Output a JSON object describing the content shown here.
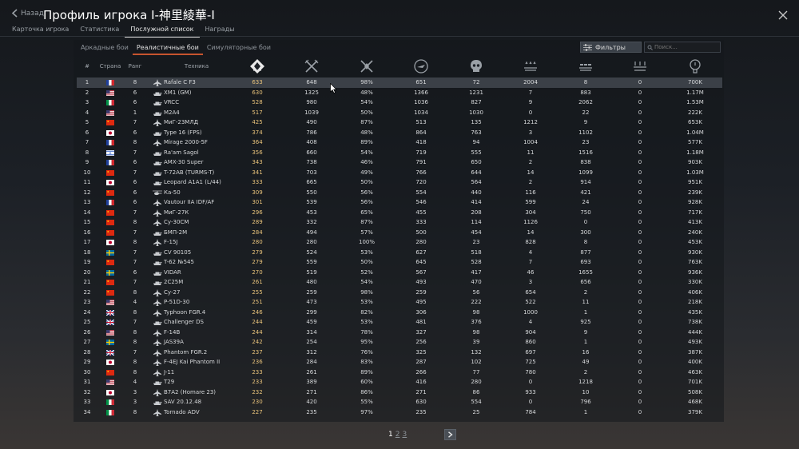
{
  "header": {
    "back_label": "Назад",
    "title": "Профиль игрока I-神里綾華-I",
    "tabs": [
      {
        "label": "Карточка игрока",
        "active": false
      },
      {
        "label": "Статистика",
        "active": false
      },
      {
        "label": "Послужной список",
        "active": true
      },
      {
        "label": "Награды",
        "active": false
      }
    ]
  },
  "modes": [
    {
      "label": "Аркадные бои",
      "active": false
    },
    {
      "label": "Реалистичные бои",
      "active": true
    },
    {
      "label": "Симуляторные бои",
      "active": false
    }
  ],
  "filters_label": "Фильтры",
  "search_placeholder": "Поиск...",
  "columns": {
    "num": "#",
    "country": "Страна",
    "rank": "Ранг",
    "vehicle": "Техника",
    "stat_icons": [
      "score-icon",
      "battles-icon",
      "victories-icon",
      "respawns-icon",
      "deaths-icon",
      "air-kills-icon",
      "ground-kills-icon",
      "naval-kills-icon",
      "experience-icon"
    ]
  },
  "flag_colors": {
    "fr": [
      "#1f3f9a",
      "#ffffff",
      "#d0282e"
    ],
    "us": [
      "#b22234",
      "#ffffff",
      "#3c3b6e"
    ],
    "it": [
      "#009246",
      "#ffffff",
      "#ce2b37"
    ],
    "cn": [
      "#de2910",
      "#ffde00"
    ],
    "jp": [
      "#ffffff",
      "#bc002d"
    ],
    "il": [
      "#ffffff",
      "#0038b8"
    ],
    "sv": [
      "#006aa7",
      "#fecc00"
    ],
    "uk": [
      "#012169",
      "#ffffff",
      "#c8102e"
    ]
  },
  "rows": [
    {
      "n": "1",
      "flag": "fr",
      "rank": "8",
      "type": "jet",
      "name": "Rafale C F3",
      "score": "633",
      "battles": "648",
      "wins": "98%",
      "respawns": "651",
      "deaths": "72",
      "air": "2004",
      "ground": "8",
      "naval": "0",
      "exp": "700K"
    },
    {
      "n": "2",
      "flag": "us",
      "rank": "6",
      "type": "tank",
      "name": "XM1 (GM)",
      "score": "630",
      "battles": "1325",
      "wins": "48%",
      "respawns": "1366",
      "deaths": "1231",
      "air": "7",
      "ground": "883",
      "naval": "0",
      "exp": "1.17M"
    },
    {
      "n": "3",
      "flag": "it",
      "rank": "6",
      "type": "tank",
      "name": "VRCC",
      "score": "528",
      "battles": "980",
      "wins": "54%",
      "respawns": "1036",
      "deaths": "827",
      "air": "9",
      "ground": "2062",
      "naval": "0",
      "exp": "1.53M"
    },
    {
      "n": "4",
      "flag": "us",
      "rank": "1",
      "type": "tank",
      "name": "M2A4",
      "score": "517",
      "battles": "1039",
      "wins": "50%",
      "respawns": "1034",
      "deaths": "1030",
      "air": "0",
      "ground": "22",
      "naval": "0",
      "exp": "222K"
    },
    {
      "n": "5",
      "flag": "cn",
      "rank": "7",
      "type": "jet",
      "name": "МиГ-23МЛД",
      "score": "425",
      "battles": "490",
      "wins": "87%",
      "respawns": "513",
      "deaths": "135",
      "air": "1212",
      "ground": "9",
      "naval": "0",
      "exp": "653K"
    },
    {
      "n": "6",
      "flag": "jp",
      "rank": "6",
      "type": "tank",
      "name": "Type 16 (FPS)",
      "score": "374",
      "battles": "786",
      "wins": "48%",
      "respawns": "864",
      "deaths": "763",
      "air": "3",
      "ground": "1102",
      "naval": "0",
      "exp": "1.04M"
    },
    {
      "n": "7",
      "flag": "fr",
      "rank": "8",
      "type": "jet",
      "name": "Mirage 2000-5F",
      "score": "364",
      "battles": "408",
      "wins": "89%",
      "respawns": "418",
      "deaths": "94",
      "air": "1004",
      "ground": "23",
      "naval": "0",
      "exp": "577K"
    },
    {
      "n": "8",
      "flag": "il",
      "rank": "7",
      "type": "tank",
      "name": "Ra'am Sagol",
      "score": "356",
      "battles": "660",
      "wins": "54%",
      "respawns": "719",
      "deaths": "555",
      "air": "11",
      "ground": "1516",
      "naval": "0",
      "exp": "1.18M"
    },
    {
      "n": "9",
      "flag": "fr",
      "rank": "6",
      "type": "tank",
      "name": "AMX-30 Super",
      "score": "343",
      "battles": "738",
      "wins": "46%",
      "respawns": "791",
      "deaths": "650",
      "air": "2",
      "ground": "838",
      "naval": "0",
      "exp": "903K"
    },
    {
      "n": "10",
      "flag": "cn",
      "rank": "7",
      "type": "tank",
      "name": "T-72AB (TURMS-T)",
      "score": "341",
      "battles": "703",
      "wins": "49%",
      "respawns": "766",
      "deaths": "644",
      "air": "14",
      "ground": "1099",
      "naval": "0",
      "exp": "1.03M"
    },
    {
      "n": "11",
      "flag": "jp",
      "rank": "6",
      "type": "tank",
      "name": "Leopard A1A1 (L/44)",
      "score": "333",
      "battles": "665",
      "wins": "50%",
      "respawns": "720",
      "deaths": "564",
      "air": "2",
      "ground": "914",
      "naval": "0",
      "exp": "951K"
    },
    {
      "n": "12",
      "flag": "cn",
      "rank": "6",
      "type": "heli",
      "name": "Ка-50",
      "score": "309",
      "battles": "550",
      "wins": "56%",
      "respawns": "554",
      "deaths": "440",
      "air": "116",
      "ground": "421",
      "naval": "0",
      "exp": "239K"
    },
    {
      "n": "13",
      "flag": "fr",
      "rank": "6",
      "type": "jet",
      "name": "Vautour IIA IDF/AF",
      "score": "301",
      "battles": "539",
      "wins": "56%",
      "respawns": "546",
      "deaths": "414",
      "air": "599",
      "ground": "24",
      "naval": "0",
      "exp": "928K"
    },
    {
      "n": "14",
      "flag": "cn",
      "rank": "7",
      "type": "jet",
      "name": "МиГ-27К",
      "score": "296",
      "battles": "453",
      "wins": "65%",
      "respawns": "455",
      "deaths": "208",
      "air": "304",
      "ground": "750",
      "naval": "0",
      "exp": "717K"
    },
    {
      "n": "15",
      "flag": "cn",
      "rank": "8",
      "type": "jet",
      "name": "Су-30СМ",
      "score": "289",
      "battles": "332",
      "wins": "87%",
      "respawns": "333",
      "deaths": "114",
      "air": "1126",
      "ground": "0",
      "naval": "0",
      "exp": "413K"
    },
    {
      "n": "16",
      "flag": "cn",
      "rank": "7",
      "type": "tank",
      "name": "БМП-2М",
      "score": "284",
      "battles": "494",
      "wins": "57%",
      "respawns": "500",
      "deaths": "454",
      "air": "14",
      "ground": "300",
      "naval": "0",
      "exp": "240K"
    },
    {
      "n": "17",
      "flag": "jp",
      "rank": "8",
      "type": "jet",
      "name": "F-15J",
      "score": "280",
      "battles": "280",
      "wins": "100%",
      "respawns": "280",
      "deaths": "23",
      "air": "828",
      "ground": "8",
      "naval": "0",
      "exp": "453K"
    },
    {
      "n": "18",
      "flag": "sv",
      "rank": "7",
      "type": "tank",
      "name": "CV 90105",
      "score": "279",
      "battles": "524",
      "wins": "53%",
      "respawns": "627",
      "deaths": "518",
      "air": "4",
      "ground": "877",
      "naval": "0",
      "exp": "930K"
    },
    {
      "n": "19",
      "flag": "cn",
      "rank": "7",
      "type": "tank",
      "name": "T-62 №545",
      "score": "279",
      "battles": "559",
      "wins": "50%",
      "respawns": "645",
      "deaths": "528",
      "air": "7",
      "ground": "693",
      "naval": "0",
      "exp": "763K"
    },
    {
      "n": "20",
      "flag": "sv",
      "rank": "6",
      "type": "tank",
      "name": "VIDAR",
      "score": "270",
      "battles": "519",
      "wins": "52%",
      "respawns": "567",
      "deaths": "417",
      "air": "46",
      "ground": "1655",
      "naval": "0",
      "exp": "936K"
    },
    {
      "n": "21",
      "flag": "cn",
      "rank": "7",
      "type": "tank",
      "name": "2С25М",
      "score": "261",
      "battles": "480",
      "wins": "54%",
      "respawns": "493",
      "deaths": "470",
      "air": "3",
      "ground": "656",
      "naval": "0",
      "exp": "330K"
    },
    {
      "n": "22",
      "flag": "cn",
      "rank": "8",
      "type": "jet",
      "name": "Су-27",
      "score": "255",
      "battles": "259",
      "wins": "98%",
      "respawns": "259",
      "deaths": "56",
      "air": "654",
      "ground": "2",
      "naval": "0",
      "exp": "406K"
    },
    {
      "n": "23",
      "flag": "us",
      "rank": "4",
      "type": "jet",
      "name": "P-51D-30",
      "score": "251",
      "battles": "473",
      "wins": "53%",
      "respawns": "495",
      "deaths": "222",
      "air": "522",
      "ground": "11",
      "naval": "0",
      "exp": "218K"
    },
    {
      "n": "24",
      "flag": "uk",
      "rank": "8",
      "type": "jet",
      "name": "Typhoon FGR.4",
      "score": "246",
      "battles": "299",
      "wins": "82%",
      "respawns": "306",
      "deaths": "98",
      "air": "1000",
      "ground": "1",
      "naval": "0",
      "exp": "435K"
    },
    {
      "n": "25",
      "flag": "uk",
      "rank": "7",
      "type": "tank",
      "name": "Challenger DS",
      "score": "244",
      "battles": "459",
      "wins": "53%",
      "respawns": "481",
      "deaths": "376",
      "air": "4",
      "ground": "925",
      "naval": "0",
      "exp": "738K"
    },
    {
      "n": "26",
      "flag": "us",
      "rank": "8",
      "type": "jet",
      "name": "F-14B",
      "score": "244",
      "battles": "314",
      "wins": "78%",
      "respawns": "327",
      "deaths": "98",
      "air": "904",
      "ground": "9",
      "naval": "0",
      "exp": "444K"
    },
    {
      "n": "27",
      "flag": "sv",
      "rank": "8",
      "type": "jet",
      "name": "JAS39A",
      "score": "242",
      "battles": "254",
      "wins": "95%",
      "respawns": "256",
      "deaths": "39",
      "air": "860",
      "ground": "1",
      "naval": "0",
      "exp": "493K"
    },
    {
      "n": "28",
      "flag": "uk",
      "rank": "7",
      "type": "jet",
      "name": "Phantom FGR.2",
      "score": "237",
      "battles": "312",
      "wins": "76%",
      "respawns": "325",
      "deaths": "132",
      "air": "697",
      "ground": "16",
      "naval": "0",
      "exp": "387K"
    },
    {
      "n": "29",
      "flag": "jp",
      "rank": "8",
      "type": "jet",
      "name": "F-4EJ Kai Phantom II",
      "score": "236",
      "battles": "284",
      "wins": "83%",
      "respawns": "287",
      "deaths": "102",
      "air": "725",
      "ground": "49",
      "naval": "0",
      "exp": "400K"
    },
    {
      "n": "30",
      "flag": "cn",
      "rank": "8",
      "type": "jet",
      "name": "J-11",
      "score": "233",
      "battles": "261",
      "wins": "89%",
      "respawns": "266",
      "deaths": "77",
      "air": "780",
      "ground": "2",
      "naval": "0",
      "exp": "463K"
    },
    {
      "n": "31",
      "flag": "us",
      "rank": "4",
      "type": "tank",
      "name": "T29",
      "score": "233",
      "battles": "389",
      "wins": "60%",
      "respawns": "416",
      "deaths": "280",
      "air": "0",
      "ground": "1218",
      "naval": "0",
      "exp": "701K"
    },
    {
      "n": "32",
      "flag": "jp",
      "rank": "3",
      "type": "jet",
      "name": "B7A2 (Homare 23)",
      "score": "232",
      "battles": "271",
      "wins": "86%",
      "respawns": "271",
      "deaths": "86",
      "air": "933",
      "ground": "10",
      "naval": "0",
      "exp": "508K"
    },
    {
      "n": "33",
      "flag": "it",
      "rank": "3",
      "type": "tank",
      "name": "SAV 20.12.48",
      "score": "230",
      "battles": "420",
      "wins": "55%",
      "respawns": "630",
      "deaths": "554",
      "air": "0",
      "ground": "796",
      "naval": "0",
      "exp": "468K"
    },
    {
      "n": "34",
      "flag": "it",
      "rank": "8",
      "type": "jet",
      "name": "Tornado ADV",
      "score": "227",
      "battles": "235",
      "wins": "97%",
      "respawns": "235",
      "deaths": "25",
      "air": "784",
      "ground": "1",
      "naval": "0",
      "exp": "379K"
    }
  ],
  "selected_row": "1",
  "pager": {
    "pages": [
      "1",
      "2",
      "3"
    ],
    "current": "1"
  }
}
